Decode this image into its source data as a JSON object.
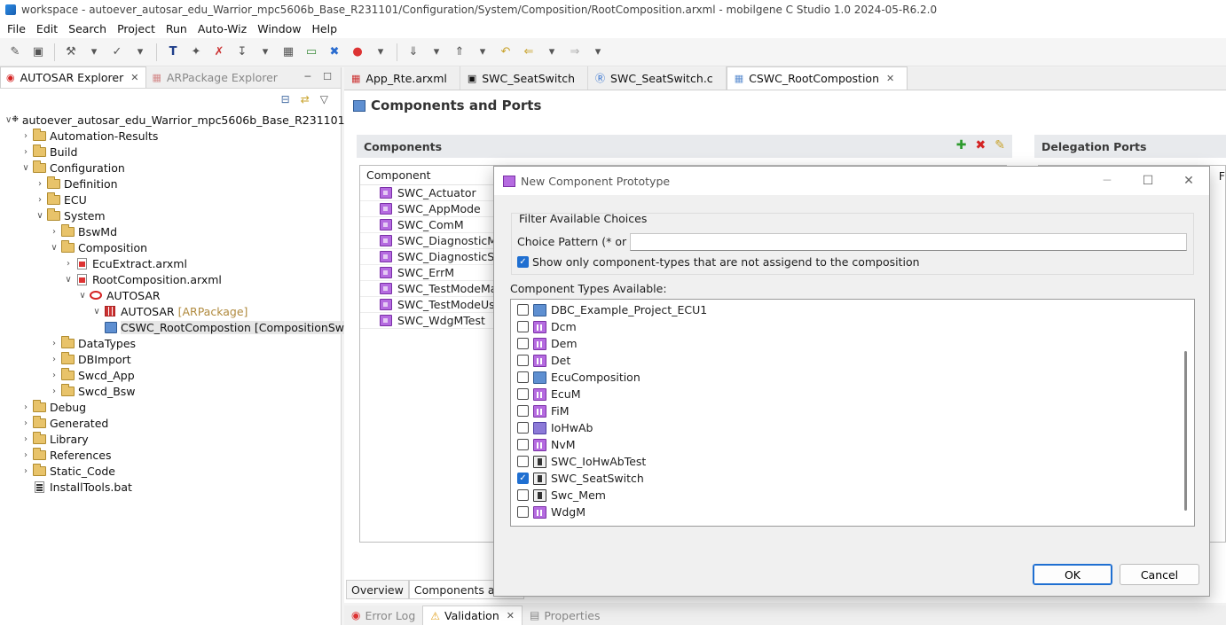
{
  "window": {
    "title": "workspace - autoever_autosar_edu_Warrior_mpc5606b_Base_R231101/Configuration/System/Composition/RootComposition.arxml - mobilgene C Studio 1.0 2024-05-R6.2.0"
  },
  "menu": [
    "File",
    "Edit",
    "Search",
    "Project",
    "Run",
    "Auto-Wiz",
    "Window",
    "Help"
  ],
  "explorer": {
    "tabs": [
      {
        "label": "AUTOSAR Explorer"
      },
      {
        "label": "ARPackage Explorer"
      }
    ],
    "tree": [
      {
        "label": "autoever_autosar_edu_Warrior_mpc5606b_Base_R231101",
        "extra": ""
      },
      {
        "label": "Automation-Results",
        "extra": ""
      },
      {
        "label": "Build",
        "extra": ""
      },
      {
        "label": "Configuration",
        "extra": ""
      },
      {
        "label": "Definition",
        "extra": ""
      },
      {
        "label": "ECU",
        "extra": ""
      },
      {
        "label": "System",
        "extra": ""
      },
      {
        "label": "BswMd",
        "extra": ""
      },
      {
        "label": "Composition",
        "extra": ""
      },
      {
        "label": "EcuExtract.arxml",
        "extra": ""
      },
      {
        "label": "RootComposition.arxml",
        "extra": ""
      },
      {
        "label": "AUTOSAR",
        "extra": ""
      },
      {
        "label": "AUTOSAR",
        "extra": "[ARPackage]"
      },
      {
        "label": "CSWC_RootCompostion [CompositionSwComponentType]",
        "extra": ""
      },
      {
        "label": "DataTypes",
        "extra": ""
      },
      {
        "label": "DBImport",
        "extra": ""
      },
      {
        "label": "Swcd_App",
        "extra": ""
      },
      {
        "label": "Swcd_Bsw",
        "extra": ""
      },
      {
        "label": "Debug",
        "extra": ""
      },
      {
        "label": "Generated",
        "extra": ""
      },
      {
        "label": "Library",
        "extra": ""
      },
      {
        "label": "References",
        "extra": ""
      },
      {
        "label": "Static_Code",
        "extra": ""
      },
      {
        "label": "InstallTools.bat",
        "extra": ""
      }
    ]
  },
  "editor": {
    "tabs": [
      {
        "label": "App_Rte.arxml"
      },
      {
        "label": "SWC_SeatSwitch"
      },
      {
        "label": "SWC_SeatSwitch.c"
      },
      {
        "label": "CSWC_RootCompostion"
      }
    ],
    "form_title": "Components and Ports",
    "components_section": "Components",
    "delegation_section": "Delegation Ports",
    "component_column": "Component",
    "delegation_column_stub": "F",
    "components": [
      "SWC_Actuator",
      "SWC_AppMode",
      "SWC_ComM",
      "SWC_DiagnosticMonitor",
      "SWC_DiagnosticService",
      "SWC_ErrM",
      "SWC_TestModeManager",
      "SWC_TestModeUser",
      "SWC_WdgMTest"
    ],
    "bottom_tabs": [
      {
        "label": "Overview"
      },
      {
        "label": "Components and P"
      }
    ]
  },
  "bottom_views": [
    {
      "label": "Error Log"
    },
    {
      "label": "Validation"
    },
    {
      "label": "Properties"
    }
  ],
  "dialog": {
    "title": "New Component Prototype",
    "filter_group": "Filter Available Choices",
    "choice_label": "Choice Pattern (* or ?)",
    "choice_value": "",
    "show_only_label": "Show only component-types that are not assigend to the composition",
    "show_only_checked": true,
    "types_label": "Component Types Available:",
    "types": [
      {
        "name": "DBC_Example_Project_ECU1",
        "icon": "ecu-composition-icon",
        "checked": false
      },
      {
        "name": "Dcm",
        "icon": "bsw-module-icon",
        "checked": false
      },
      {
        "name": "Dem",
        "icon": "bsw-module-icon",
        "checked": false
      },
      {
        "name": "Det",
        "icon": "bsw-module-icon",
        "checked": false
      },
      {
        "name": "EcuComposition",
        "icon": "ecu-composition-icon",
        "checked": false
      },
      {
        "name": "EcuM",
        "icon": "bsw-module-icon",
        "checked": false
      },
      {
        "name": "FiM",
        "icon": "bsw-module-icon",
        "checked": false
      },
      {
        "name": "IoHwAb",
        "icon": "iohwab-icon",
        "checked": false
      },
      {
        "name": "NvM",
        "icon": "bsw-module-icon",
        "checked": false
      },
      {
        "name": "SWC_IoHwAbTest",
        "icon": "application-swc-icon",
        "checked": false
      },
      {
        "name": "SWC_SeatSwitch",
        "icon": "application-swc-icon",
        "checked": true
      },
      {
        "name": "Swc_Mem",
        "icon": "application-swc-icon",
        "checked": false
      },
      {
        "name": "WdgM",
        "icon": "bsw-module-icon",
        "checked": false
      }
    ],
    "ok_label": "OK",
    "cancel_label": "Cancel"
  }
}
